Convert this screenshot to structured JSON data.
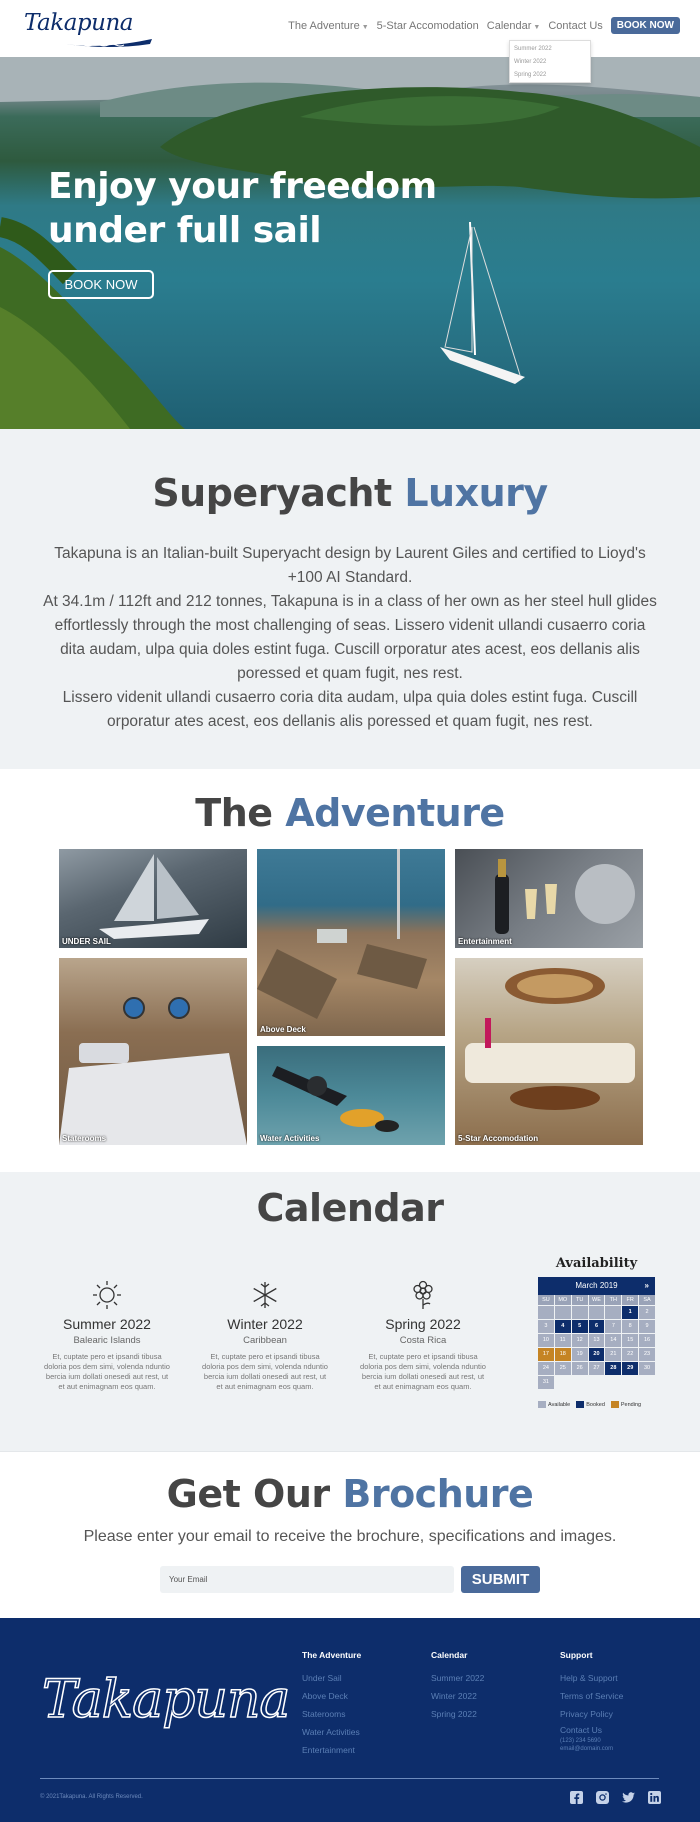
{
  "nav": {
    "logo": "Takapuna",
    "items": [
      {
        "label": "The Adventure",
        "caret": true
      },
      {
        "label": "5-Star Accomodation",
        "caret": false
      },
      {
        "label": "Calendar",
        "caret": true
      },
      {
        "label": "Contact Us",
        "caret": false
      }
    ],
    "book_now": "BOOK NOW",
    "dropdown": [
      "Summer 2022",
      "Winter 2022",
      "Spring 2022"
    ]
  },
  "hero": {
    "title_line1": "Enjoy your freedom",
    "title_line2": "under full sail",
    "button": "BOOK NOW"
  },
  "luxury": {
    "title_main": "Superyacht ",
    "title_accent": "Luxury",
    "paragraph1": "Takapuna is an Italian-built Superyacht design by Laurent Giles and certified to Lioyd's +100 AI Standard.",
    "paragraph2": "At 34.1m / 112ft and 212 tonnes, Takapuna is in a class of her own as her steel hull glides effortlessly through the most challenging of seas. Lissero videnit ullandi cusaerro coria dita audam, ulpa quia doles estint fuga. Cuscill orporatur ates acest, eos dellanis alis poressed et quam fugit, nes rest.",
    "paragraph3": "Lissero videnit ullandi cusaerro coria dita audam, ulpa quia doles estint fuga. Cuscill orporatur ates acest, eos dellanis alis poressed et quam fugit, nes rest."
  },
  "adventure": {
    "title_main": "The ",
    "title_accent": "Adventure",
    "tiles": [
      "UNDER SAIL",
      "Above Deck",
      "Entertainment",
      "Staterooms",
      "Water Activities",
      "5-Star Accomodation"
    ]
  },
  "calendar": {
    "title": "Calendar",
    "seasons": [
      {
        "icon": "sun-icon",
        "name": "Summer 2022",
        "location": "Balearic Islands",
        "desc": "Et, cuptate pero et ipsandi tibusa doloria pos dem simi, volenda nduntio bercia ium dollati onesedi aut rest, ut et aut enimagnam eos quam."
      },
      {
        "icon": "snowflake-icon",
        "name": "Winter 2022",
        "location": "Caribbean",
        "desc": "Et, cuptate pero et ipsandi tibusa doloria pos dem simi, volenda nduntio bercia ium dollati onesedi aut rest, ut et aut enimagnam eos quam."
      },
      {
        "icon": "flower-icon",
        "name": "Spring 2022",
        "location": "Costa Rica",
        "desc": "Et, cuptate pero et ipsandi tibusa doloria pos dem simi, volenda nduntio bercia ium dollati onesedi aut rest, ut et aut enimagnam eos quam."
      }
    ],
    "availability": {
      "title": "Availability",
      "month": "March 2019",
      "next": "»",
      "days_of_week": [
        "SU",
        "MO",
        "TU",
        "WE",
        "TH",
        "FR",
        "SA"
      ],
      "cells": [
        {
          "d": "",
          "s": "e"
        },
        {
          "d": "",
          "s": "e"
        },
        {
          "d": "",
          "s": "e"
        },
        {
          "d": "",
          "s": "e"
        },
        {
          "d": "",
          "s": "e"
        },
        {
          "d": "1",
          "s": "b"
        },
        {
          "d": "2",
          "s": "a"
        },
        {
          "d": "3",
          "s": "a"
        },
        {
          "d": "4",
          "s": "b"
        },
        {
          "d": "5",
          "s": "b"
        },
        {
          "d": "6",
          "s": "b"
        },
        {
          "d": "7",
          "s": "a"
        },
        {
          "d": "8",
          "s": "a"
        },
        {
          "d": "9",
          "s": "a"
        },
        {
          "d": "10",
          "s": "a"
        },
        {
          "d": "11",
          "s": "a"
        },
        {
          "d": "12",
          "s": "a"
        },
        {
          "d": "13",
          "s": "a"
        },
        {
          "d": "14",
          "s": "a"
        },
        {
          "d": "15",
          "s": "a"
        },
        {
          "d": "16",
          "s": "a"
        },
        {
          "d": "17",
          "s": "p"
        },
        {
          "d": "18",
          "s": "p"
        },
        {
          "d": "19",
          "s": "a"
        },
        {
          "d": "20",
          "s": "b"
        },
        {
          "d": "21",
          "s": "a"
        },
        {
          "d": "22",
          "s": "a"
        },
        {
          "d": "23",
          "s": "a"
        },
        {
          "d": "24",
          "s": "a"
        },
        {
          "d": "25",
          "s": "a"
        },
        {
          "d": "26",
          "s": "a"
        },
        {
          "d": "27",
          "s": "a"
        },
        {
          "d": "28",
          "s": "b"
        },
        {
          "d": "29",
          "s": "b"
        },
        {
          "d": "30",
          "s": "a"
        },
        {
          "d": "31",
          "s": "a"
        }
      ],
      "legend": [
        {
          "label": "Available",
          "color": "#a6aec1"
        },
        {
          "label": "Booked",
          "color": "#0d2d6b"
        },
        {
          "label": "Pending",
          "color": "#c58424"
        }
      ]
    }
  },
  "brochure": {
    "title_main": "Get Our ",
    "title_accent": "Brochure",
    "subtitle": "Please enter your email to receive the brochure, specifications and images.",
    "email_placeholder": "Your Email",
    "submit": "SUBMIT"
  },
  "footer": {
    "logo": "Takapuna",
    "columns": [
      {
        "title": "The Adventure",
        "links": [
          "Under Sail",
          "Above Deck",
          "Staterooms",
          "Water Activities",
          "Entertainment"
        ]
      },
      {
        "title": "Calendar",
        "links": [
          "Summer 2022",
          "Winter 2022",
          "Spring 2022"
        ]
      },
      {
        "title": "Support",
        "links": [
          "Help & Support",
          "Terms of Service",
          "Privacy Policy",
          "Contact Us"
        ],
        "small": [
          "(123) 234 5690",
          "email@domain.com"
        ]
      }
    ],
    "copyright": "© 2021Takapuna. All Rights Reserved.",
    "social": [
      "facebook-icon",
      "instagram-icon",
      "twitter-icon",
      "linkedin-icon"
    ]
  },
  "colors": {
    "brand_navy": "#0d2d6b",
    "accent_blue": "#4f74a3",
    "pending": "#c58424"
  }
}
